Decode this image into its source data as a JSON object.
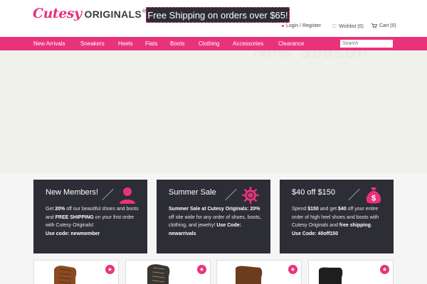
{
  "header": {
    "logo_cutesy": "Cutesy",
    "logo_originals": "ORIGINALS",
    "logo_reg": "®",
    "promo_text": "Free Shipping on orders over $65!",
    "login_label": "Login / Register",
    "wishlist_label": "Wishlist (0)",
    "cart_label": "Cart (0)"
  },
  "nav": {
    "items": [
      "New Arrivals",
      "Sneakers",
      "Heels",
      "Flats",
      "Boots",
      "Clothing",
      "Accessories",
      "Clearance"
    ],
    "search_placeholder": "Search"
  },
  "hero": {
    "text": "New Season"
  },
  "cards": [
    {
      "title": "New Members!",
      "icon": "person-icon",
      "line1": "Get ",
      "bold1": "20%",
      "line2": " off our beautiful shoes and boots and ",
      "bold2": "FREE SHIPPING",
      "line3": " on your first order with Cutesy Originals!",
      "code": "Use code: newmember"
    },
    {
      "title": "Summer Sale",
      "icon": "sun-icon",
      "bold1": "Summer Sale at Cutesy Originals: 20%",
      "line2": " off site wide for any order of shoes, boots, clothing, and jewelry! ",
      "code": "Use Code: newarrivals"
    },
    {
      "title": "$40 off $150",
      "icon": "money-bag-icon",
      "line1": "Spend ",
      "bold1": "$150",
      "line2": " and get ",
      "bold2": "$40",
      "line3": " off your entire order of high heel shoes and boots with Cutesy Originals and ",
      "bold3": "free shipping",
      "line4": ".",
      "code": "Use Code: 40off150"
    }
  ],
  "products": [
    {
      "icon": "star-icon",
      "color": "#8b4a22"
    },
    {
      "icon": "star-icon",
      "color": "#3a3530"
    },
    {
      "icon": "star-icon",
      "color": "#6b3d1e"
    },
    {
      "icon": "star-icon",
      "color": "#1e1e1e"
    }
  ],
  "colors": {
    "accent": "#e8337c",
    "dark": "#2d2d35",
    "hero_bg": "#f1f1ec"
  }
}
